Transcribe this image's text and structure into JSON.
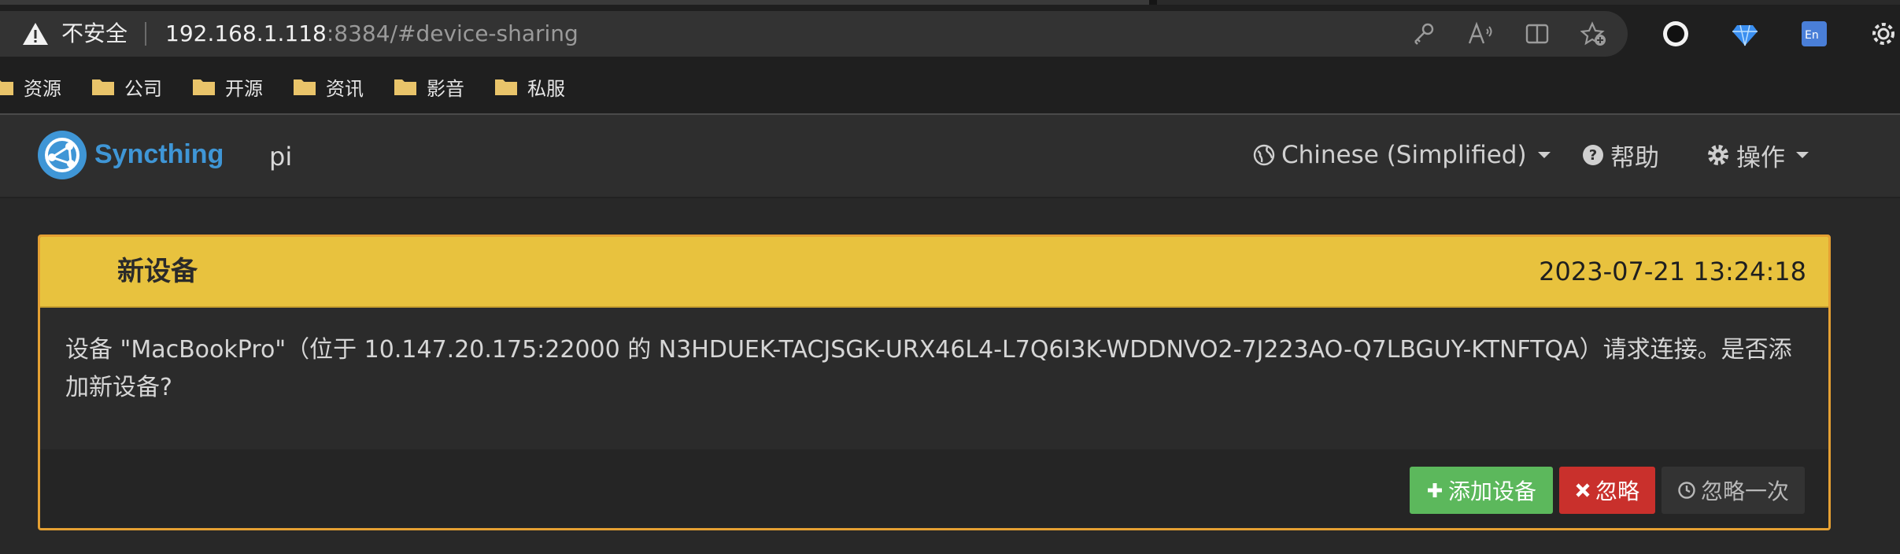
{
  "browser": {
    "security_label": "不安全",
    "url_host": "192.168.1.118",
    "url_rest": ":8384/#device-sharing",
    "bookmarks": [
      {
        "label": "资源"
      },
      {
        "label": "公司"
      },
      {
        "label": "开源"
      },
      {
        "label": "资讯"
      },
      {
        "label": "影音"
      },
      {
        "label": "私服"
      }
    ],
    "toolbar_icons": [
      "key-icon",
      "read-aloud-icon",
      "split-screen-icon",
      "add-favorite-icon"
    ],
    "extension_icons": [
      "record-extension-icon",
      "diamond-extension-icon",
      "translate-extension-icon",
      "gear-extension-icon"
    ]
  },
  "navbar": {
    "brand": "Syncthing",
    "device_name": "pi",
    "language_label": "Chinese (Simplified)",
    "help_label": "帮助",
    "actions_label": "操作"
  },
  "notification": {
    "title": "新设备",
    "timestamp": "2023-07-21 13:24:18",
    "message": "设备 \"MacBookPro\"（位于 10.147.20.175:22000 的 N3HDUEK-TACJSGK-URX46L4-L7Q6I3K-WDDNVO2-7J223AO-Q7LBGUY-KTNFTQA）请求连接。是否添加新设备?",
    "buttons": {
      "add": "添加设备",
      "ignore": "忽略",
      "dismiss": "忽略一次"
    }
  },
  "colors": {
    "brand_blue": "#3f96d6",
    "warning_yellow": "#e8c23e",
    "panel_border": "#e5a033",
    "success_green": "#5cb85c",
    "danger_red": "#c9302c"
  }
}
